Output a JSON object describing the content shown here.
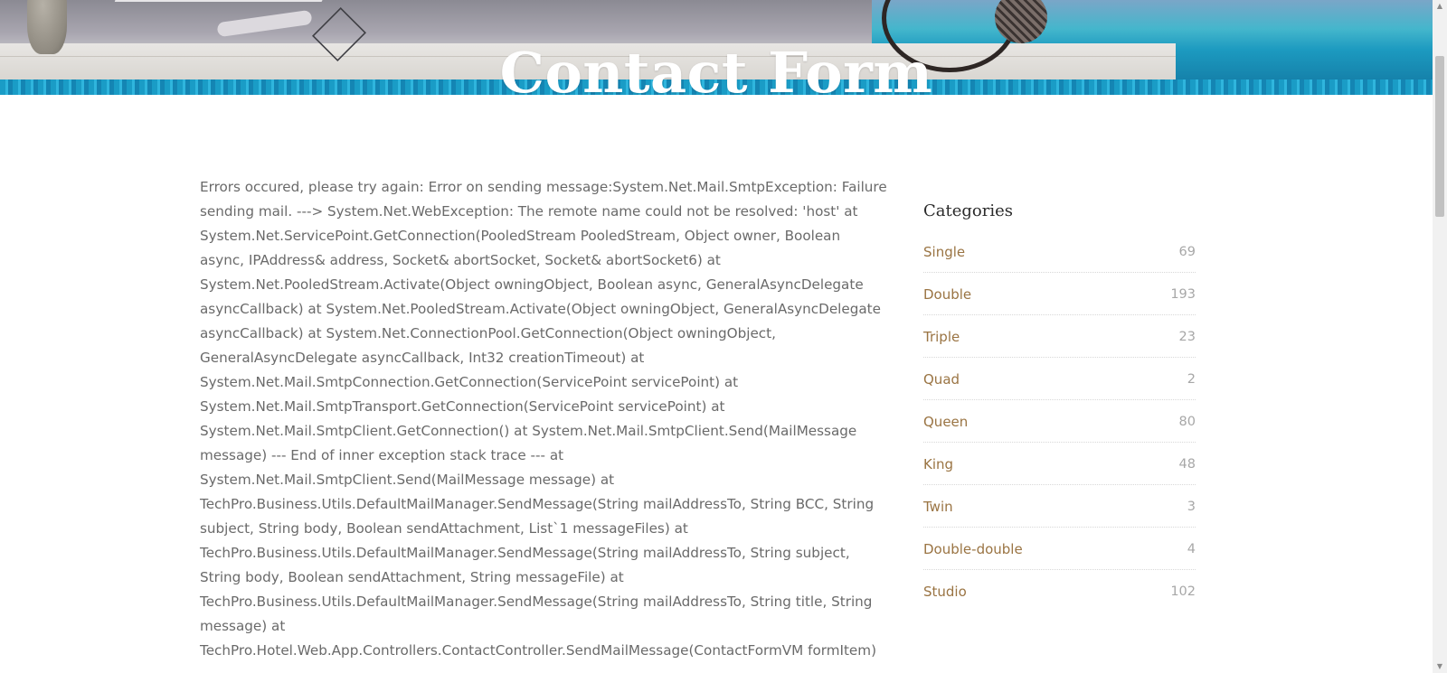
{
  "hero": {
    "title": "Contact Form"
  },
  "main": {
    "error_message": "Errors occured, please try again: Error on sending message:System.Net.Mail.SmtpException: Failure sending mail. ---> System.Net.WebException: The remote name could not be resolved: 'host' at System.Net.ServicePoint.GetConnection(PooledStream PooledStream, Object owner, Boolean async, IPAddress& address, Socket& abortSocket, Socket& abortSocket6) at System.Net.PooledStream.Activate(Object owningObject, Boolean async, GeneralAsyncDelegate asyncCallback) at System.Net.PooledStream.Activate(Object owningObject, GeneralAsyncDelegate asyncCallback) at System.Net.ConnectionPool.GetConnection(Object owningObject, GeneralAsyncDelegate asyncCallback, Int32 creationTimeout) at System.Net.Mail.SmtpConnection.GetConnection(ServicePoint servicePoint) at System.Net.Mail.SmtpTransport.GetConnection(ServicePoint servicePoint) at System.Net.Mail.SmtpClient.GetConnection() at System.Net.Mail.SmtpClient.Send(MailMessage message) --- End of inner exception stack trace --- at System.Net.Mail.SmtpClient.Send(MailMessage message) at TechPro.Business.Utils.DefaultMailManager.SendMessage(String mailAddressTo, String BCC, String subject, String body, Boolean sendAttachment, List`1 messageFiles) at TechPro.Business.Utils.DefaultMailManager.SendMessage(String mailAddressTo, String subject, String body, Boolean sendAttachment, String messageFile) at TechPro.Business.Utils.DefaultMailManager.SendMessage(String mailAddressTo, String title, String message) at TechPro.Hotel.Web.App.Controllers.ContactController.SendMailMessage(ContactFormVM formItem)"
  },
  "sidebar": {
    "title": "Categories",
    "categories": [
      {
        "name": "Single",
        "count": "69"
      },
      {
        "name": "Double",
        "count": "193"
      },
      {
        "name": "Triple",
        "count": "23"
      },
      {
        "name": "Quad",
        "count": "2"
      },
      {
        "name": "Queen",
        "count": "80"
      },
      {
        "name": "King",
        "count": "48"
      },
      {
        "name": "Twin",
        "count": "3"
      },
      {
        "name": "Double-double",
        "count": "4"
      },
      {
        "name": "Studio",
        "count": "102"
      }
    ]
  },
  "scrollbar": {
    "up_arrow": "▲",
    "down_arrow": "▼"
  },
  "colors": {
    "category_link": "#9a7443",
    "category_count": "#a7a7a7",
    "body_text": "#6a6a6a",
    "hero_water": "#1a9cc6"
  },
  "icons": [
    "scroll-up-arrow-icon",
    "scroll-down-arrow-icon"
  ]
}
